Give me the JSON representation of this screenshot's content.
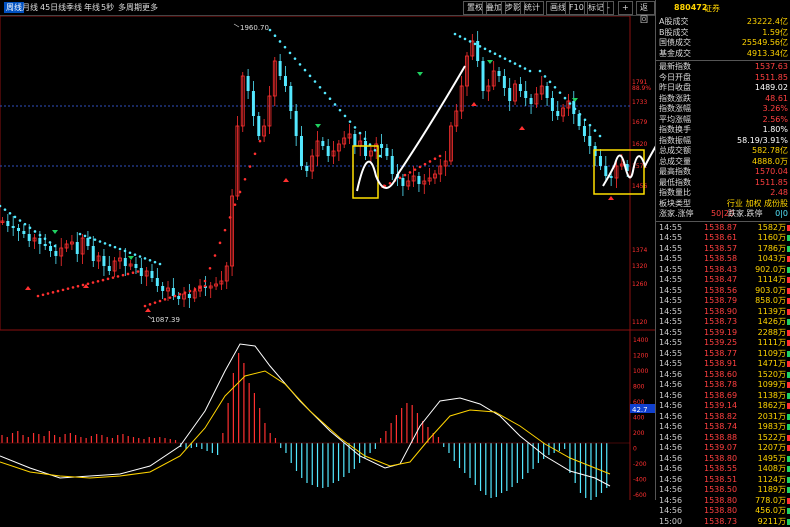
{
  "toolbar": {
    "items": [
      "周线",
      "月线",
      "45日线",
      "季线",
      "年线",
      "5秒",
      "多周期",
      "更多"
    ],
    "active_index": 0,
    "right_items": [
      "置权",
      "叠加",
      "步影",
      "统计",
      "画线",
      "F10",
      "标记",
      "-",
      "+",
      "返回"
    ]
  },
  "chart_annotations": {
    "high_label": "1960.70",
    "low_label": "1087.39",
    "indicator_value": "42.7",
    "main_axis_ticks": [
      "1791",
      "88.9%",
      "1733",
      "1679",
      "1620",
      "1572",
      "1456",
      "1374",
      "1320",
      "1260",
      "1120"
    ],
    "macd_axis_ticks": [
      "1400",
      "1200",
      "1000",
      "800",
      "600",
      "400",
      "200",
      "0",
      "-200",
      "-400",
      "-600"
    ]
  },
  "panel": {
    "code": "880472",
    "name": "证券",
    "stats": [
      {
        "label": "A股成交",
        "value": "23222.4亿",
        "color": "#ffd400"
      },
      {
        "label": "B股成交",
        "value": "1.59亿",
        "color": "#ffd400"
      },
      {
        "label": "国债成交",
        "value": "25549.56亿",
        "color": "#ffd400"
      },
      {
        "label": "基金成交",
        "value": "4913.34亿",
        "color": "#ffd400"
      }
    ],
    "quotes": [
      {
        "label": "最新指数",
        "value": "1537.63",
        "color": "#ff4040"
      },
      {
        "label": "今日开盘",
        "value": "1511.85",
        "color": "#ff4040"
      },
      {
        "label": "昨日收盘",
        "value": "1489.02",
        "color": "#ffffff"
      },
      {
        "label": "指数涨跌",
        "value": "48.61",
        "color": "#ff4040"
      },
      {
        "label": "指数涨幅",
        "value": "3.26%",
        "color": "#ff4040"
      },
      {
        "label": "平均涨幅",
        "value": "2.56%",
        "color": "#ff4040"
      },
      {
        "label": "指数换手",
        "value": "1.80%",
        "color": "#ffffff"
      },
      {
        "label": "指数振幅",
        "value": "58.19/3.91%",
        "color": "#ffffff"
      },
      {
        "label": "总成交额",
        "value": "582.78亿",
        "color": "#ffd400"
      },
      {
        "label": "总成交量",
        "value": "4888.0万",
        "color": "#ffd400"
      },
      {
        "label": "最高指数",
        "value": "1570.04",
        "color": "#ff4040"
      },
      {
        "label": "最低指数",
        "value": "1511.85",
        "color": "#ff4040"
      },
      {
        "label": "指数量比",
        "value": "2.48",
        "color": "#ff4040"
      }
    ],
    "sector_row": {
      "label": "板块类型",
      "value": "行业 加权 成份股"
    },
    "breadth_row": {
      "label": "涨家.涨停",
      "mid": "50|20",
      "label2": "跌家.跌停",
      "value": "0|0"
    },
    "ticks": [
      {
        "time": "14:55",
        "price": "1538.87",
        "vol": "1582万",
        "up": true
      },
      {
        "time": "14:55",
        "price": "1538.61",
        "vol": "1160万",
        "up": false
      },
      {
        "time": "14:55",
        "price": "1538.57",
        "vol": "1786万",
        "up": false
      },
      {
        "time": "14:55",
        "price": "1538.58",
        "vol": "1043万",
        "up": true
      },
      {
        "time": "14:55",
        "price": "1538.43",
        "vol": "902.0万",
        "up": false
      },
      {
        "time": "14:55",
        "price": "1538.47",
        "vol": "1114万",
        "up": true
      },
      {
        "time": "14:55",
        "price": "1538.56",
        "vol": "903.0万",
        "up": true
      },
      {
        "time": "14:55",
        "price": "1538.79",
        "vol": "858.0万",
        "up": true
      },
      {
        "time": "14:55",
        "price": "1538.90",
        "vol": "1139万",
        "up": true
      },
      {
        "time": "14:55",
        "price": "1538.73",
        "vol": "1426万",
        "up": false
      },
      {
        "time": "14:55",
        "price": "1539.19",
        "vol": "2288万",
        "up": true
      },
      {
        "time": "14:55",
        "price": "1539.25",
        "vol": "1111万",
        "up": true
      },
      {
        "time": "14:55",
        "price": "1538.77",
        "vol": "1109万",
        "up": false
      },
      {
        "time": "14:55",
        "price": "1538.91",
        "vol": "1471万",
        "up": true
      },
      {
        "time": "14:56",
        "price": "1538.60",
        "vol": "1520万",
        "up": false
      },
      {
        "time": "14:56",
        "price": "1538.78",
        "vol": "1099万",
        "up": true
      },
      {
        "time": "14:56",
        "price": "1538.69",
        "vol": "1138万",
        "up": false
      },
      {
        "time": "14:56",
        "price": "1539.14",
        "vol": "1862万",
        "up": true
      },
      {
        "time": "14:56",
        "price": "1538.82",
        "vol": "2031万",
        "up": false
      },
      {
        "time": "14:56",
        "price": "1538.74",
        "vol": "1983万",
        "up": false
      },
      {
        "time": "14:56",
        "price": "1538.88",
        "vol": "1522万",
        "up": true
      },
      {
        "time": "14:56",
        "price": "1539.07",
        "vol": "1207万",
        "up": true
      },
      {
        "time": "14:56",
        "price": "1538.80",
        "vol": "1495万",
        "up": false
      },
      {
        "time": "14:56",
        "price": "1538.55",
        "vol": "1408万",
        "up": false
      },
      {
        "time": "14:56",
        "price": "1538.51",
        "vol": "1124万",
        "up": false
      },
      {
        "time": "14:56",
        "price": "1538.50",
        "vol": "1189万",
        "up": false
      },
      {
        "time": "14:56",
        "price": "1538.80",
        "vol": "778.0万",
        "up": true
      },
      {
        "time": "14:56",
        "price": "1538.80",
        "vol": "456.0万",
        "up": false
      },
      {
        "time": "15:00",
        "price": "1538.73",
        "vol": "9211万",
        "up": false
      }
    ]
  },
  "colors": {
    "up": "#ff3030",
    "down": "#54e8ff",
    "dif": "#ffffff",
    "dea": "#ffd400",
    "highlight": "#ffe000"
  }
}
